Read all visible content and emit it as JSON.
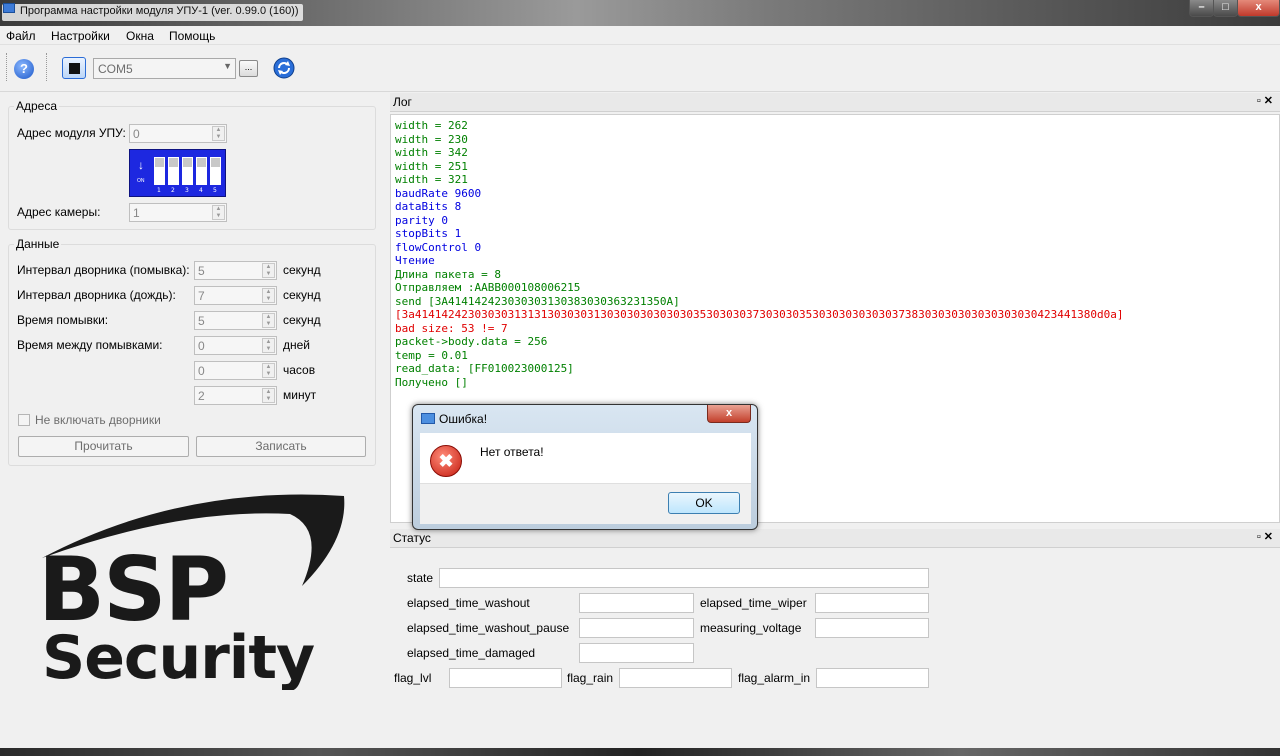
{
  "window": {
    "title": "Программа настройки модуля УПУ-1 (ver. 0.99.0 (160))",
    "controls": {
      "minimize": "–",
      "maximize": "□",
      "close": "x"
    }
  },
  "menu": [
    "Файл",
    "Настройки",
    "Окна",
    "Помощь"
  ],
  "toolbar": {
    "help_glyph": "?",
    "port_value": "COM5",
    "combo_arrow": "▼",
    "browse_label": "..."
  },
  "addresses": {
    "title": "Адреса",
    "module_label": "Адрес модуля УПУ:",
    "module_value": "0",
    "camera_label": "Адрес камеры:",
    "camera_value": "1",
    "dip": {
      "on_label": "ON",
      "numbers": [
        "1",
        "2",
        "3",
        "4",
        "5"
      ]
    }
  },
  "data_group": {
    "title": "Данные",
    "rows": [
      {
        "label": "Интервал дворника (помывка):",
        "value": "5",
        "unit": "секунд"
      },
      {
        "label": "Интервал дворника (дождь):",
        "value": "7",
        "unit": "секунд"
      },
      {
        "label": "Время помывки:",
        "value": "5",
        "unit": "секунд"
      },
      {
        "label": "Время между помывками:",
        "value": "0",
        "unit": "дней"
      },
      {
        "label": "",
        "value": "0",
        "unit": "часов"
      },
      {
        "label": "",
        "value": "2",
        "unit": "минут"
      }
    ],
    "checkbox_label": "Не включать дворники",
    "read_button": "Прочитать",
    "write_button": "Записать"
  },
  "logo": {
    "line1": "BSP",
    "line2": "Security"
  },
  "log_panel": {
    "title": "Лог",
    "controls": "▫✕",
    "lines": [
      {
        "text": "width = 262",
        "color": "#008000"
      },
      {
        "text": "width = 230",
        "color": "#008000"
      },
      {
        "text": "width = 342",
        "color": "#008000"
      },
      {
        "text": "width = 251",
        "color": "#008000"
      },
      {
        "text": "width = 321",
        "color": "#008000"
      },
      {
        "text": "baudRate 9600",
        "color": "#0000e0"
      },
      {
        "text": "dataBits 8",
        "color": "#0000e0"
      },
      {
        "text": "parity 0",
        "color": "#0000e0"
      },
      {
        "text": "stopBits 1",
        "color": "#0000e0"
      },
      {
        "text": "flowControl 0",
        "color": "#0000e0"
      },
      {
        "text": "Чтение",
        "color": "#0000e0"
      },
      {
        "text": "Длина пакета = 8",
        "color": "#008000"
      },
      {
        "text": "Отправляем :AABB000108006215",
        "color": "#008000"
      },
      {
        "text": "send [3A414142423030303130383030363231350A]",
        "color": "#008000"
      },
      {
        "text": "[3a4141424230303031313130303031303030303030303530303037303030353030303030303738303030303030303030423441380d0a]",
        "color": "#e00000"
      },
      {
        "text": "bad size: 53 != 7",
        "color": "#e00000"
      },
      {
        "text": "packet->body.data = 256",
        "color": "#008000"
      },
      {
        "text": "temp = 0.01",
        "color": "#008000"
      },
      {
        "text": "read_data: [FF010023000125]",
        "color": "#008000"
      },
      {
        "text": "Получено []",
        "color": "#008000"
      }
    ]
  },
  "status_panel": {
    "title": "Статус",
    "controls": "▫✕",
    "fields": {
      "state": "state",
      "elapsed_time_washout": "elapsed_time_washout",
      "elapsed_time_wiper": "elapsed_time_wiper",
      "elapsed_time_washout_pause": "elapsed_time_washout_pause",
      "measuring_voltage": "measuring_voltage",
      "elapsed_time_damaged": "elapsed_time_damaged",
      "flag_lvl": "flag_lvl",
      "flag_rain": "flag_rain",
      "flag_alarm_in": "flag_alarm_in"
    }
  },
  "dialog": {
    "title": "Ошибка!",
    "close_glyph": "x",
    "error_glyph": "✖",
    "message": "Нет ответа!",
    "ok_label": "OK"
  }
}
